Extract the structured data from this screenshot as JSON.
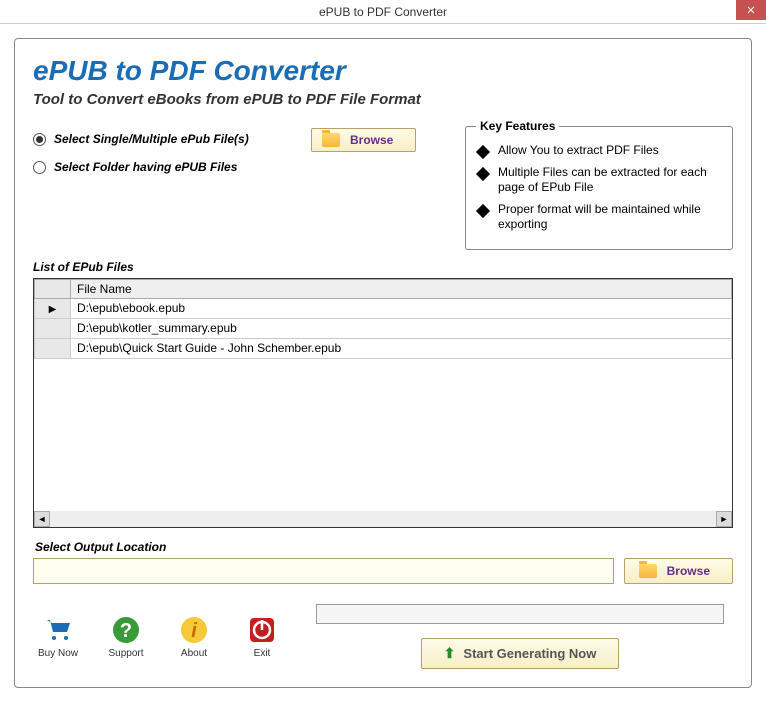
{
  "window": {
    "title": "ePUB to PDF Converter"
  },
  "header": {
    "title": "ePUB to PDF Converter",
    "subtitle": "Tool to Convert eBooks from ePUB to PDF File Format"
  },
  "source": {
    "radio1": "Select Single/Multiple ePub File(s)",
    "radio2": "Select Folder having ePUB Files",
    "selected": 0,
    "browse_label": "Browse"
  },
  "features": {
    "title": "Key Features",
    "items": [
      "Allow You to extract PDF Files",
      "Multiple Files can be extracted for each page of EPub File",
      "Proper format will be maintained while exporting"
    ]
  },
  "list": {
    "label": "List of EPub Files",
    "header": "File Name",
    "rows": [
      "D:\\epub\\ebook.epub",
      "D:\\epub\\kotler_summary.epub",
      "D:\\epub\\Quick Start Guide - John Schember.epub"
    ]
  },
  "output": {
    "label": "Select  Output Location",
    "value": "",
    "browse_label": "Browse"
  },
  "actions": {
    "buy": "Buy Now",
    "support": "Support",
    "about": "About",
    "exit": "Exit",
    "generate": "Start Generating Now"
  }
}
